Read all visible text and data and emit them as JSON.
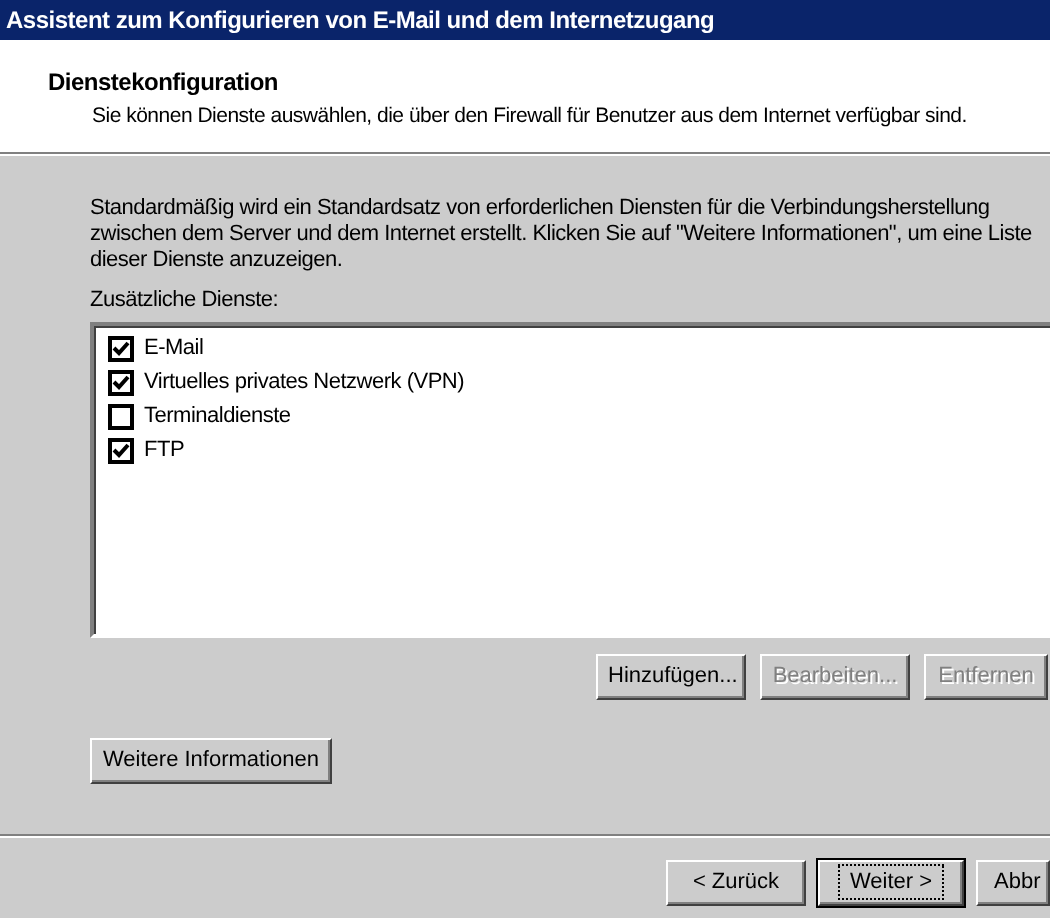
{
  "window": {
    "title": "Assistent zum Konfigurieren von E-Mail und dem Internetzugang"
  },
  "header": {
    "title": "Dienstekonfiguration",
    "subtitle": "Sie können Dienste auswählen, die über den Firewall für Benutzer aus dem Internet verfügbar sind."
  },
  "description": "Standardmäßig wird ein Standardsatz von erforderlichen Diensten für die Verbindungsherstellung zwischen dem Server und dem Internet erstellt. Klicken Sie auf \"Weitere Informationen\", um eine Liste dieser Dienste anzuzeigen.",
  "services_label": "Zusätzliche Dienste:",
  "services": [
    {
      "label": "E-Mail",
      "checked": true
    },
    {
      "label": "Virtuelles privates Netzwerk (VPN)",
      "checked": true
    },
    {
      "label": "Terminaldienste",
      "checked": false
    },
    {
      "label": "FTP",
      "checked": true
    }
  ],
  "list_buttons": [
    {
      "label": "Hinzufügen...",
      "disabled": false
    },
    {
      "label": "Bearbeiten...",
      "disabled": true
    },
    {
      "label": "Entfernen",
      "disabled": true
    }
  ],
  "info_button": "Weitere Informationen",
  "nav_buttons": [
    {
      "label": "< Zurück",
      "default": false
    },
    {
      "label": "Weiter >",
      "default": true
    },
    {
      "label": "Abbr",
      "default": false
    }
  ]
}
